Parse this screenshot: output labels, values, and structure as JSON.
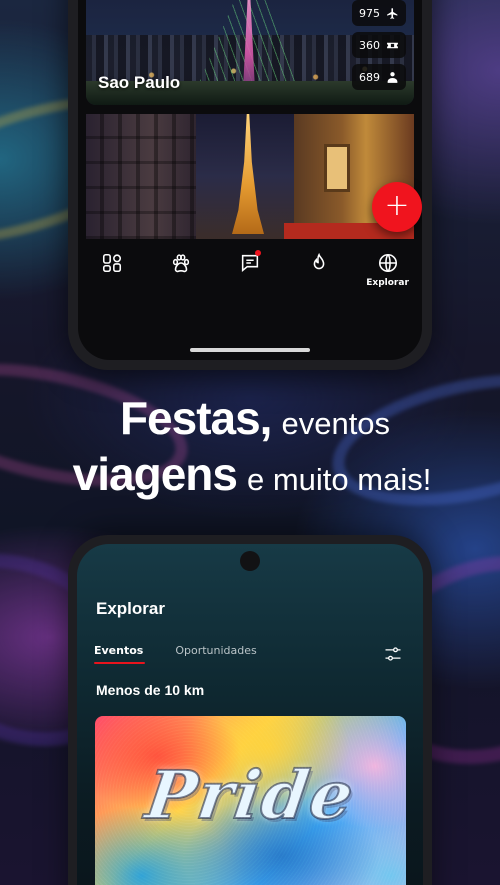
{
  "top_phone": {
    "city_card": {
      "title": "Sao Paulo",
      "stats": [
        {
          "value": "975",
          "icon": "plane-icon"
        },
        {
          "value": "360",
          "icon": "ticket-icon"
        },
        {
          "value": "689",
          "icon": "person-icon"
        }
      ]
    },
    "fab_label": "+",
    "nav": {
      "explore_label": "Explorar",
      "has_chat_notification": true
    }
  },
  "headline": {
    "line1_bold": "Festas,",
    "line1_light": "eventos",
    "line2_bold": "viagens",
    "line2_light": "e muito mais!"
  },
  "bottom_phone": {
    "title": "Explorar",
    "tabs": [
      {
        "label": "Eventos",
        "active": true
      },
      {
        "label": "Oportunidades",
        "active": false
      }
    ],
    "section_title": "Menos de 10 km",
    "event_card_text": "Pride"
  },
  "colors": {
    "accent_red": "#f0141e"
  }
}
